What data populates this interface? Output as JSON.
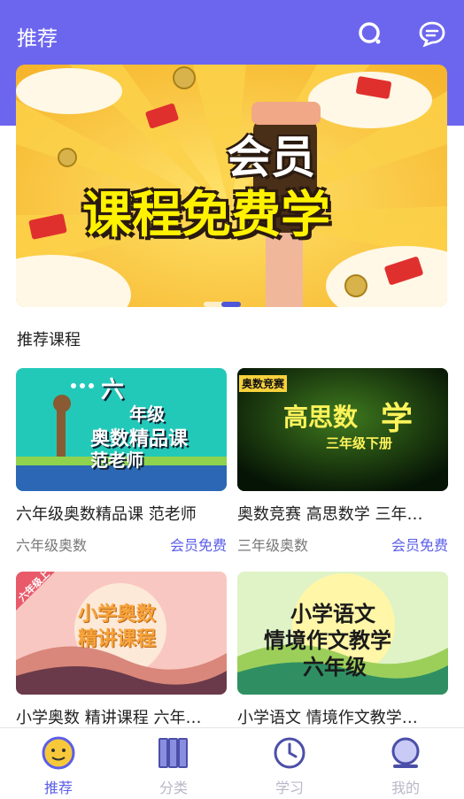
{
  "header": {
    "title": "推荐",
    "search_icon": "search-icon",
    "message_icon": "chat-bubble-icon"
  },
  "banner": {
    "line1": "会员",
    "line2": "课程免费学"
  },
  "section": {
    "title": "推荐课程"
  },
  "courses": [
    {
      "title": "六年级奥数精品课 范老师",
      "category": "六年级奥数",
      "badge": "会员免费",
      "thumb": {
        "l1": "六",
        "l2": "年级",
        "l3": "奥数精品课",
        "l4": "范老师"
      }
    },
    {
      "title": "奥数竞赛 高思数学 三年…",
      "category": "三年级奥数",
      "badge": "会员免费",
      "thumb": {
        "tag": "奥数竞赛",
        "l1": "高思数",
        "l2": "学",
        "l3": "三年级下册"
      }
    },
    {
      "title": "小学奥数 精讲课程 六年…",
      "thumb": {
        "corner": "六年级上",
        "l1": "小学奥数",
        "l2": "精讲课程"
      }
    },
    {
      "title": "小学语文 情境作文教学…",
      "thumb": {
        "l1": "小学语文",
        "l2": "情境作文教学",
        "l3": "六年级"
      }
    }
  ],
  "tabs": [
    {
      "label": "推荐",
      "icon": "smiley-icon"
    },
    {
      "label": "分类",
      "icon": "books-icon"
    },
    {
      "label": "学习",
      "icon": "clock-icon"
    },
    {
      "label": "我的",
      "icon": "profile-icon"
    }
  ],
  "colors": {
    "brand": "#6c66ee",
    "accent": "#5b5ee8"
  }
}
